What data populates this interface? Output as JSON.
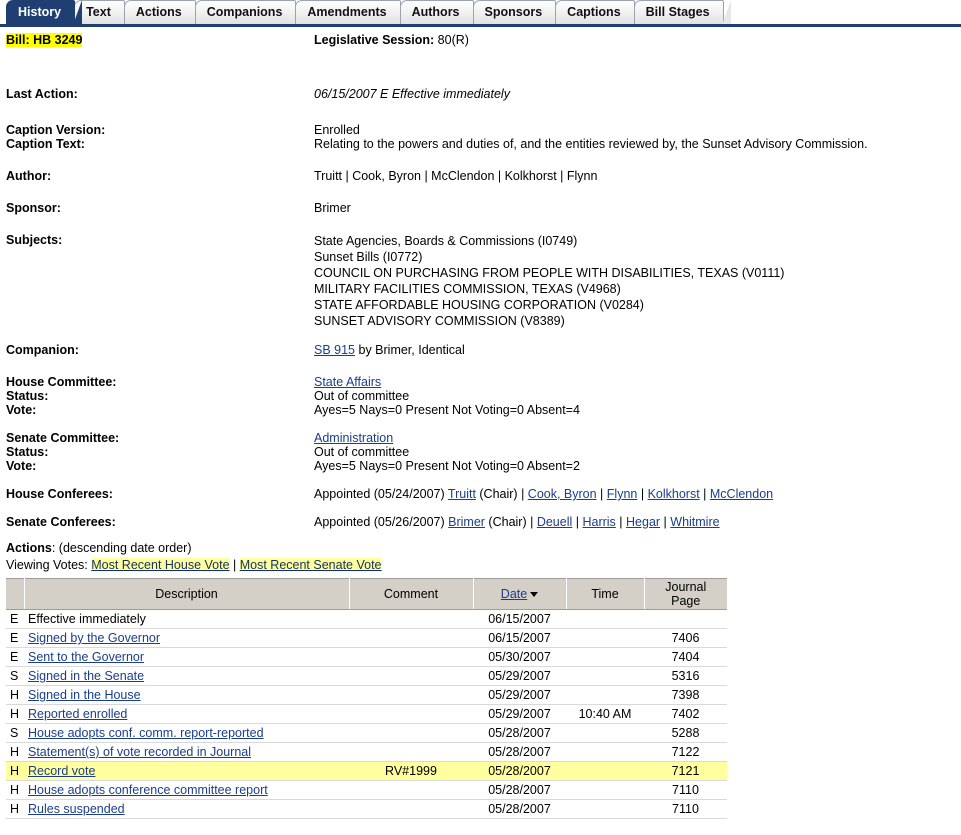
{
  "tabs": [
    {
      "label": "History",
      "active": true
    },
    {
      "label": "Text",
      "active": false
    },
    {
      "label": "Actions",
      "active": false
    },
    {
      "label": "Companions",
      "active": false
    },
    {
      "label": "Amendments",
      "active": false
    },
    {
      "label": "Authors",
      "active": false
    },
    {
      "label": "Sponsors",
      "active": false
    },
    {
      "label": "Captions",
      "active": false
    },
    {
      "label": "Bill Stages",
      "active": false
    }
  ],
  "header": {
    "bill_label": "Bill:",
    "bill_number": "HB 3249",
    "session_label": "Legislative Session:",
    "session_value": "80(R)"
  },
  "fields": {
    "last_action_label": "Last Action:",
    "last_action_value": "06/15/2007 E Effective immediately",
    "caption_version_label": "Caption Version:",
    "caption_version_value": "Enrolled",
    "caption_text_label": "Caption Text:",
    "caption_text_value": "Relating to the powers and duties of, and the entities reviewed by, the Sunset Advisory Commission.",
    "author_label": "Author:",
    "author_value": "Truitt | Cook, Byron | McClendon | Kolkhorst | Flynn",
    "sponsor_label": "Sponsor:",
    "sponsor_value": "Brimer",
    "subjects_label": "Subjects:",
    "subjects": [
      "State Agencies, Boards & Commissions (I0749)",
      "Sunset Bills (I0772)",
      "COUNCIL ON PURCHASING FROM PEOPLE WITH DISABILITIES, TEXAS (V0111)",
      "MILITARY FACILITIES COMMISSION, TEXAS (V4968)",
      "STATE AFFORDABLE HOUSING CORPORATION (V0284)",
      "SUNSET ADVISORY COMMISSION (V8389)"
    ],
    "companion_label": "Companion:",
    "companion_link": "SB 915",
    "companion_rest": " by Brimer, Identical",
    "house_committee_label": "House Committee:",
    "house_committee_link": "State Affairs",
    "house_status_label": "Status:",
    "house_status_value": "Out of committee",
    "house_vote_label": "Vote:",
    "house_vote_value": "Ayes=5   Nays=0   Present Not Voting=0   Absent=4",
    "senate_committee_label": "Senate Committee:",
    "senate_committee_link": "Administration",
    "senate_status_label": "Status:",
    "senate_status_value": "Out of committee",
    "senate_vote_label": "Vote:",
    "senate_vote_value": "Ayes=5   Nays=0   Present Not Voting=0   Absent=2",
    "house_conferees_label": "House Conferees:",
    "house_conferees_prefix": "Appointed (05/24/2007) ",
    "house_conferees": [
      {
        "name": "Truitt",
        "suffix": " (Chair)"
      },
      {
        "name": "Cook, Byron",
        "suffix": ""
      },
      {
        "name": "Flynn",
        "suffix": ""
      },
      {
        "name": "Kolkhorst",
        "suffix": ""
      },
      {
        "name": "McClendon",
        "suffix": ""
      }
    ],
    "senate_conferees_label": "Senate Conferees:",
    "senate_conferees_prefix": "Appointed (05/26/2007) ",
    "senate_conferees": [
      {
        "name": "Brimer",
        "suffix": " (Chair)"
      },
      {
        "name": "Deuell",
        "suffix": ""
      },
      {
        "name": "Harris",
        "suffix": ""
      },
      {
        "name": "Hegar",
        "suffix": ""
      },
      {
        "name": "Whitmire",
        "suffix": ""
      }
    ]
  },
  "actions": {
    "title": "Actions",
    "title_note": ": (descending date order)",
    "viewing_votes_label": "Viewing Votes: ",
    "vote_links": [
      "Most Recent House Vote",
      "Most Recent Senate Vote"
    ],
    "vote_links_separator": " | ",
    "columns": [
      "Description",
      "Comment",
      "Date",
      "Time",
      "Journal Page"
    ],
    "sort_column": "Date",
    "sort_direction": "descending",
    "rows": [
      {
        "chamber": "E",
        "description": "Effective immediately",
        "link": false,
        "comment": "",
        "date": "06/15/2007",
        "time": "",
        "page": "",
        "highlight": false
      },
      {
        "chamber": "E",
        "description": "Signed by the Governor",
        "link": true,
        "comment": "",
        "date": "06/15/2007",
        "time": "",
        "page": "7406",
        "highlight": false
      },
      {
        "chamber": "E",
        "description": "Sent to the Governor",
        "link": true,
        "comment": "",
        "date": "05/30/2007",
        "time": "",
        "page": "7404",
        "highlight": false
      },
      {
        "chamber": "S",
        "description": "Signed in the Senate",
        "link": true,
        "comment": "",
        "date": "05/29/2007",
        "time": "",
        "page": "5316",
        "highlight": false
      },
      {
        "chamber": "H",
        "description": "Signed in the House",
        "link": true,
        "comment": "",
        "date": "05/29/2007",
        "time": "",
        "page": "7398",
        "highlight": false
      },
      {
        "chamber": "H",
        "description": "Reported enrolled",
        "link": true,
        "comment": "",
        "date": "05/29/2007",
        "time": "10:40 AM",
        "page": "7402",
        "highlight": false
      },
      {
        "chamber": "S",
        "description": "House adopts conf. comm. report-reported",
        "link": true,
        "comment": "",
        "date": "05/28/2007",
        "time": "",
        "page": "5288",
        "highlight": false
      },
      {
        "chamber": "H",
        "description": "Statement(s) of vote recorded in Journal",
        "link": true,
        "comment": "",
        "date": "05/28/2007",
        "time": "",
        "page": "7122",
        "highlight": false
      },
      {
        "chamber": "H",
        "description": "Record vote",
        "link": true,
        "comment": "RV#1999",
        "date": "05/28/2007",
        "time": "",
        "page": "7121",
        "highlight": true
      },
      {
        "chamber": "H",
        "description": "House adopts conference committee report",
        "link": true,
        "comment": "",
        "date": "05/28/2007",
        "time": "",
        "page": "7110",
        "highlight": false
      },
      {
        "chamber": "H",
        "description": "Rules suspended",
        "link": true,
        "comment": "",
        "date": "05/28/2007",
        "time": "",
        "page": "7110",
        "highlight": false
      }
    ]
  },
  "colors": {
    "tab_active_bg": "#1f3f73",
    "highlight_yellow": "#ffff00",
    "highlight_soft": "#ffff9e",
    "link": "#1a3e8c",
    "table_header_bg": "#d4d0c8"
  }
}
